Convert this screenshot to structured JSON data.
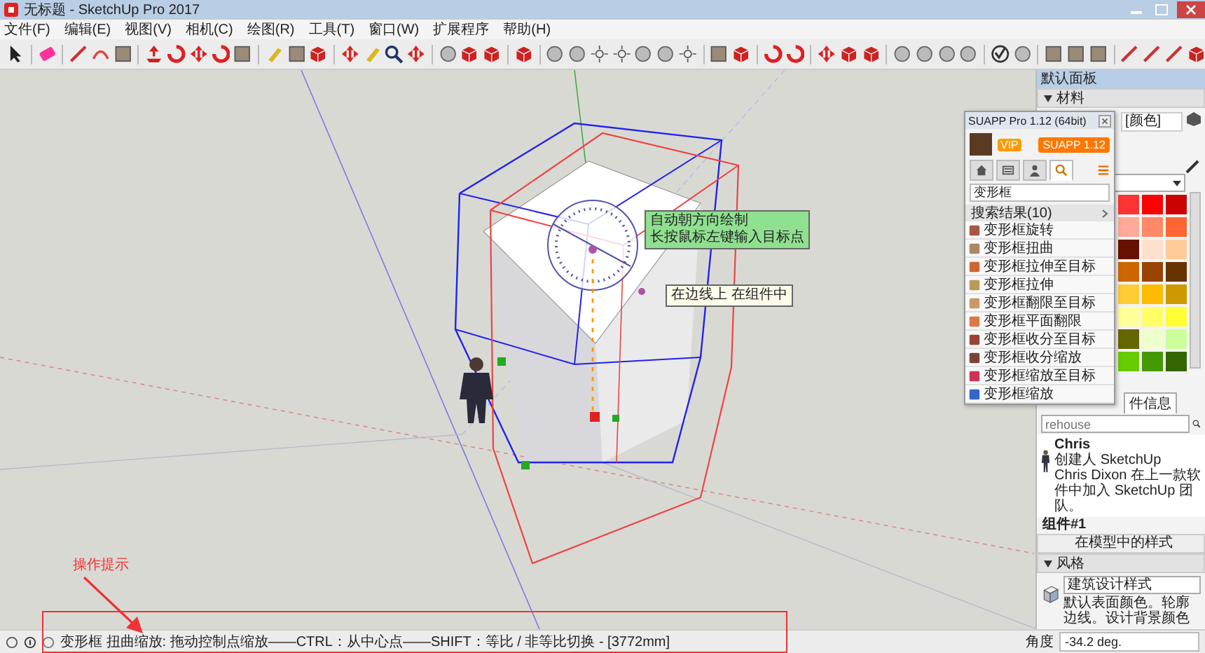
{
  "window": {
    "title": "无标题 - SketchUp Pro 2017"
  },
  "menu": [
    "文件(F)",
    "编辑(E)",
    "视图(V)",
    "相机(C)",
    "绘图(R)",
    "工具(T)",
    "窗口(W)",
    "扩展程序",
    "帮助(H)"
  ],
  "canvas": {
    "tooltips": [
      {
        "kind": "hint",
        "lines": [
          "自动朝方向绘制",
          "长按鼠标左键输入目标点"
        ]
      },
      {
        "kind": "inference",
        "lines": [
          "在边线上 在组件中"
        ]
      }
    ]
  },
  "annotation": {
    "label": "操作提示"
  },
  "suapp": {
    "title": "SUAPP Pro 1.12 (64bit)",
    "badge": "VIP",
    "version_button": "SUAPP 1.12",
    "tabs": [
      {
        "selected": false
      },
      {
        "selected": false
      },
      {
        "selected": false
      },
      {
        "selected": true
      }
    ],
    "search": {
      "value": "变形框"
    },
    "results_header": "搜索结果(10)",
    "items": [
      "变形框旋转",
      "变形框扭曲",
      "变形框拉伸至目标",
      "变形框拉伸",
      "变形框翻限至目标",
      "变形框平面翻限",
      "变形框收分至目标",
      "变形框收分缩放",
      "变形框缩放至目标",
      "变形框缩放"
    ]
  },
  "tray": {
    "title": "默认面板",
    "materials": {
      "header": "材料",
      "expanded": true,
      "name_field": "[颜色]",
      "swatches": [
        {
          "color": "#ff3333"
        },
        {
          "color": "#ff0000"
        },
        {
          "color": "#cc0000"
        },
        {
          "color": "#ffaa99"
        },
        {
          "color": "#ff8866"
        },
        {
          "color": "#ff6633"
        },
        {
          "color": "#661100"
        },
        {
          "color": "#ffe0cc"
        },
        {
          "color": "#ffcc99"
        },
        {
          "color": "#cc6600"
        },
        {
          "color": "#994400"
        },
        {
          "color": "#663300"
        },
        {
          "color": "#ffcc33"
        },
        {
          "color": "#ffbb00"
        },
        {
          "color": "#cc9900"
        },
        {
          "color": "#ffff99"
        },
        {
          "color": "#ffff66"
        },
        {
          "color": "#ffff33"
        },
        {
          "color": "#666600"
        },
        {
          "color": "#eeffcc"
        },
        {
          "color": "#ccff99"
        },
        {
          "color": "#66cc00"
        },
        {
          "color": "#449900"
        },
        {
          "color": "#336600"
        }
      ]
    },
    "components": {
      "tab": "件信息",
      "search": {
        "placeholder": "rehouse"
      },
      "name": "Chris",
      "author": "创建人 SketchUp",
      "description": "Chris Dixon 在上一款软件中加入 SketchUp 团队。",
      "count": "组件#1",
      "in_model": "在模型中的样式"
    },
    "styles": {
      "header": "风格",
      "expanded": true,
      "name_field": "建筑设计样式",
      "description": "默认表面颜色。轮廓边线。设计背景颜色"
    }
  },
  "status_bar": {
    "text": "变形框 扭曲缩放: 拖动控制点缩放——CTRL：从中心点——SHIFT：等比 / 非等比切换 - [3772mm]",
    "measure_label": "角度",
    "measure_value": "-34.2 deg."
  }
}
